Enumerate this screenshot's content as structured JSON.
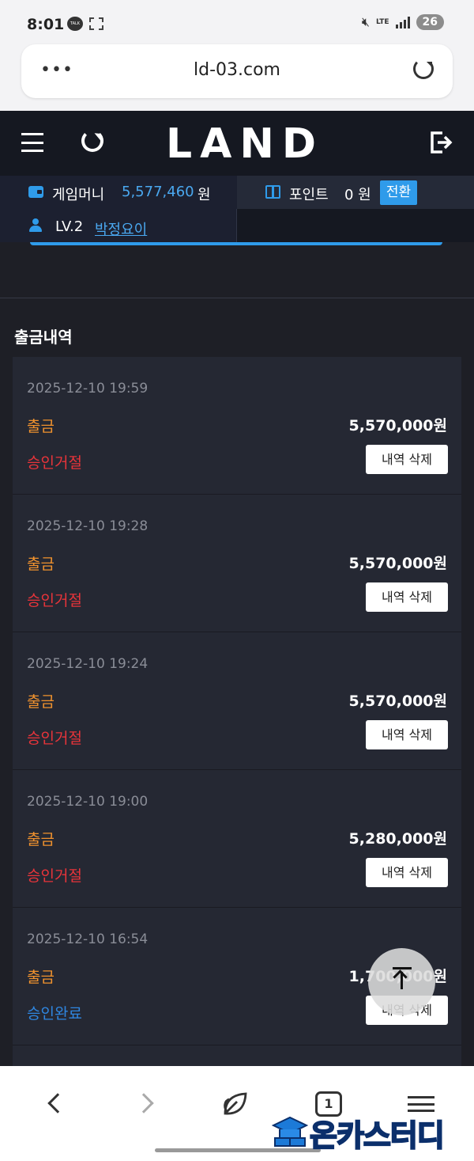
{
  "status_bar": {
    "time": "8:01",
    "talk_badge": "TALK",
    "network": "LTE",
    "battery": "26"
  },
  "browser": {
    "url": "ld-03.com",
    "tab_count": "1"
  },
  "header": {
    "logo": "LAND"
  },
  "account": {
    "money_label": "게임머니",
    "money_value": "5,577,460",
    "money_unit": "원",
    "point_label": "포인트",
    "point_value": "0 원",
    "convert_label": "전환",
    "level": "LV.2",
    "nickname": "박정요이"
  },
  "withdrawals": {
    "title": "출금내역",
    "items": [
      {
        "date": "2025-12-10 19:59",
        "type": "출금",
        "amount": "5,570,000원",
        "status": "승인거절",
        "delete_label": "내역 삭제"
      },
      {
        "date": "2025-12-10 19:28",
        "type": "출금",
        "amount": "5,570,000원",
        "status": "승인거절",
        "delete_label": "내역 삭제"
      },
      {
        "date": "2025-12-10 19:24",
        "type": "출금",
        "amount": "5,570,000원",
        "status": "승인거절",
        "delete_label": "내역 삭제"
      },
      {
        "date": "2025-12-10 19:00",
        "type": "출금",
        "amount": "5,280,000원",
        "status": "승인거절",
        "delete_label": "내역 삭제"
      },
      {
        "date": "2025-12-10 16:54",
        "type": "출금",
        "amount": "1,700,000원",
        "status": "승인완료",
        "delete_label": "내역 삭제"
      }
    ]
  },
  "watermark": {
    "text": "온카스터디"
  },
  "colors": {
    "accent": "#2f9bea",
    "rejected": "#e8343a",
    "approved": "#2f86e0",
    "withdraw_type": "#f0922e",
    "background": "#1e1f26",
    "card": "#252833"
  }
}
